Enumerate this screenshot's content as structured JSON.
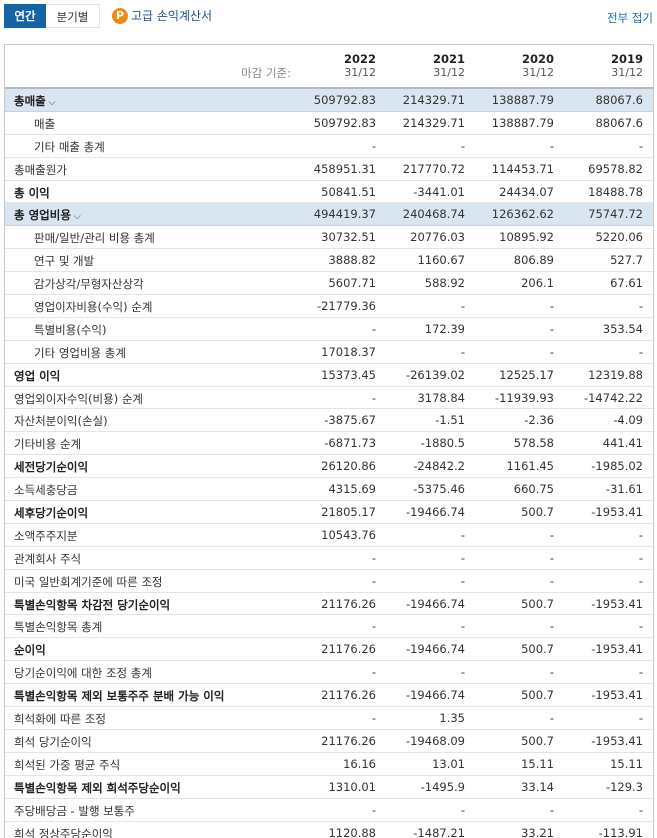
{
  "tabs": {
    "annual": "연간",
    "quarterly": "분기별"
  },
  "premium": {
    "icon_label": "P",
    "label": "고급 손익계산서"
  },
  "collapse_all": "전부 접기",
  "header": {
    "label": "마감 기준:",
    "columns": [
      {
        "year": "2022",
        "date": "31/12"
      },
      {
        "year": "2021",
        "date": "31/12"
      },
      {
        "year": "2020",
        "date": "31/12"
      },
      {
        "year": "2019",
        "date": "31/12"
      }
    ]
  },
  "rows": [
    {
      "label": "총매출",
      "kind": "section",
      "values": [
        "509792.83",
        "214329.71",
        "138887.79",
        "88067.6"
      ]
    },
    {
      "label": "매출",
      "kind": "sub",
      "values": [
        "509792.83",
        "214329.71",
        "138887.79",
        "88067.6"
      ]
    },
    {
      "label": "기타 매출 총계",
      "kind": "sub",
      "values": [
        "-",
        "-",
        "-",
        "-"
      ]
    },
    {
      "label": "총매출원가",
      "kind": "normal",
      "values": [
        "458951.31",
        "217770.72",
        "114453.71",
        "69578.82"
      ]
    },
    {
      "label": "총 이익",
      "kind": "bold",
      "values": [
        "50841.51",
        "-3441.01",
        "24434.07",
        "18488.78"
      ]
    },
    {
      "label": "총 영업비용",
      "kind": "section",
      "values": [
        "494419.37",
        "240468.74",
        "126362.62",
        "75747.72"
      ]
    },
    {
      "label": "판매/일반/관리 비용 총계",
      "kind": "sub",
      "values": [
        "30732.51",
        "20776.03",
        "10895.92",
        "5220.06"
      ]
    },
    {
      "label": "연구 및 개발",
      "kind": "sub",
      "values": [
        "3888.82",
        "1160.67",
        "806.89",
        "527.7"
      ]
    },
    {
      "label": "감가상각/무형자산상각",
      "kind": "sub",
      "values": [
        "5607.71",
        "588.92",
        "206.1",
        "67.61"
      ]
    },
    {
      "label": "영업이자비용(수익) 순계",
      "kind": "sub",
      "values": [
        "-21779.36",
        "-",
        "-",
        "-"
      ]
    },
    {
      "label": "특별비용(수익)",
      "kind": "sub",
      "values": [
        "-",
        "172.39",
        "-",
        "353.54"
      ]
    },
    {
      "label": "기타 영업비용 총계",
      "kind": "sub",
      "values": [
        "17018.37",
        "-",
        "-",
        "-"
      ]
    },
    {
      "label": "영업 이익",
      "kind": "bold",
      "values": [
        "15373.45",
        "-26139.02",
        "12525.17",
        "12319.88"
      ]
    },
    {
      "label": "영업외이자수익(비용) 순계",
      "kind": "normal",
      "values": [
        "-",
        "3178.84",
        "-11939.93",
        "-14742.22"
      ]
    },
    {
      "label": "자산처분이익(손실)",
      "kind": "normal",
      "values": [
        "-3875.67",
        "-1.51",
        "-2.36",
        "-4.09"
      ]
    },
    {
      "label": "기타비용 순계",
      "kind": "normal",
      "values": [
        "-6871.73",
        "-1880.5",
        "578.58",
        "441.41"
      ]
    },
    {
      "label": "세전당기순이익",
      "kind": "bold",
      "values": [
        "26120.86",
        "-24842.2",
        "1161.45",
        "-1985.02"
      ]
    },
    {
      "label": "소득세충당금",
      "kind": "normal",
      "values": [
        "4315.69",
        "-5375.46",
        "660.75",
        "-31.61"
      ]
    },
    {
      "label": "세후당기순이익",
      "kind": "bold",
      "values": [
        "21805.17",
        "-19466.74",
        "500.7",
        "-1953.41"
      ]
    },
    {
      "label": "소액주주지분",
      "kind": "normal",
      "values": [
        "10543.76",
        "-",
        "-",
        "-"
      ]
    },
    {
      "label": "관계회사 주식",
      "kind": "normal",
      "values": [
        "-",
        "-",
        "-",
        "-"
      ]
    },
    {
      "label": "미국 일반회계기준에 따른 조정",
      "kind": "normal",
      "values": [
        "-",
        "-",
        "-",
        "-"
      ]
    },
    {
      "label": "특별손익항목 차감전 당기순이익",
      "kind": "bold",
      "values": [
        "21176.26",
        "-19466.74",
        "500.7",
        "-1953.41"
      ]
    },
    {
      "label": "특별손익항목 총계",
      "kind": "normal",
      "values": [
        "-",
        "-",
        "-",
        "-"
      ]
    },
    {
      "label": "순이익",
      "kind": "bold",
      "values": [
        "21176.26",
        "-19466.74",
        "500.7",
        "-1953.41"
      ]
    },
    {
      "label": "당기순이익에 대한 조정 총계",
      "kind": "normal",
      "values": [
        "-",
        "-",
        "-",
        "-"
      ]
    },
    {
      "label": "특별손익항목 제외 보통주주 분배 가능 이익",
      "kind": "bold",
      "values": [
        "21176.26",
        "-19466.74",
        "500.7",
        "-1953.41"
      ]
    },
    {
      "label": "희석화에 따른 조정",
      "kind": "normal",
      "values": [
        "-",
        "1.35",
        "-",
        "-"
      ]
    },
    {
      "label": "희석 당기순이익",
      "kind": "normal",
      "values": [
        "21176.26",
        "-19468.09",
        "500.7",
        "-1953.41"
      ]
    },
    {
      "label": "희석된 가중 평균 주식",
      "kind": "normal",
      "values": [
        "16.16",
        "13.01",
        "15.11",
        "15.11"
      ]
    },
    {
      "label": "특별손익항목 제외 희석주당순이익",
      "kind": "bold",
      "values": [
        "1310.01",
        "-1495.9",
        "33.14",
        "-129.3"
      ]
    },
    {
      "label": "주당배당금 - 발행 보통주",
      "kind": "normal",
      "values": [
        "-",
        "-",
        "-",
        "-"
      ]
    },
    {
      "label": "희석 정상주당순이익",
      "kind": "normal",
      "values": [
        "1120.88",
        "-1487.21",
        "33.21",
        "-113.91"
      ]
    }
  ]
}
